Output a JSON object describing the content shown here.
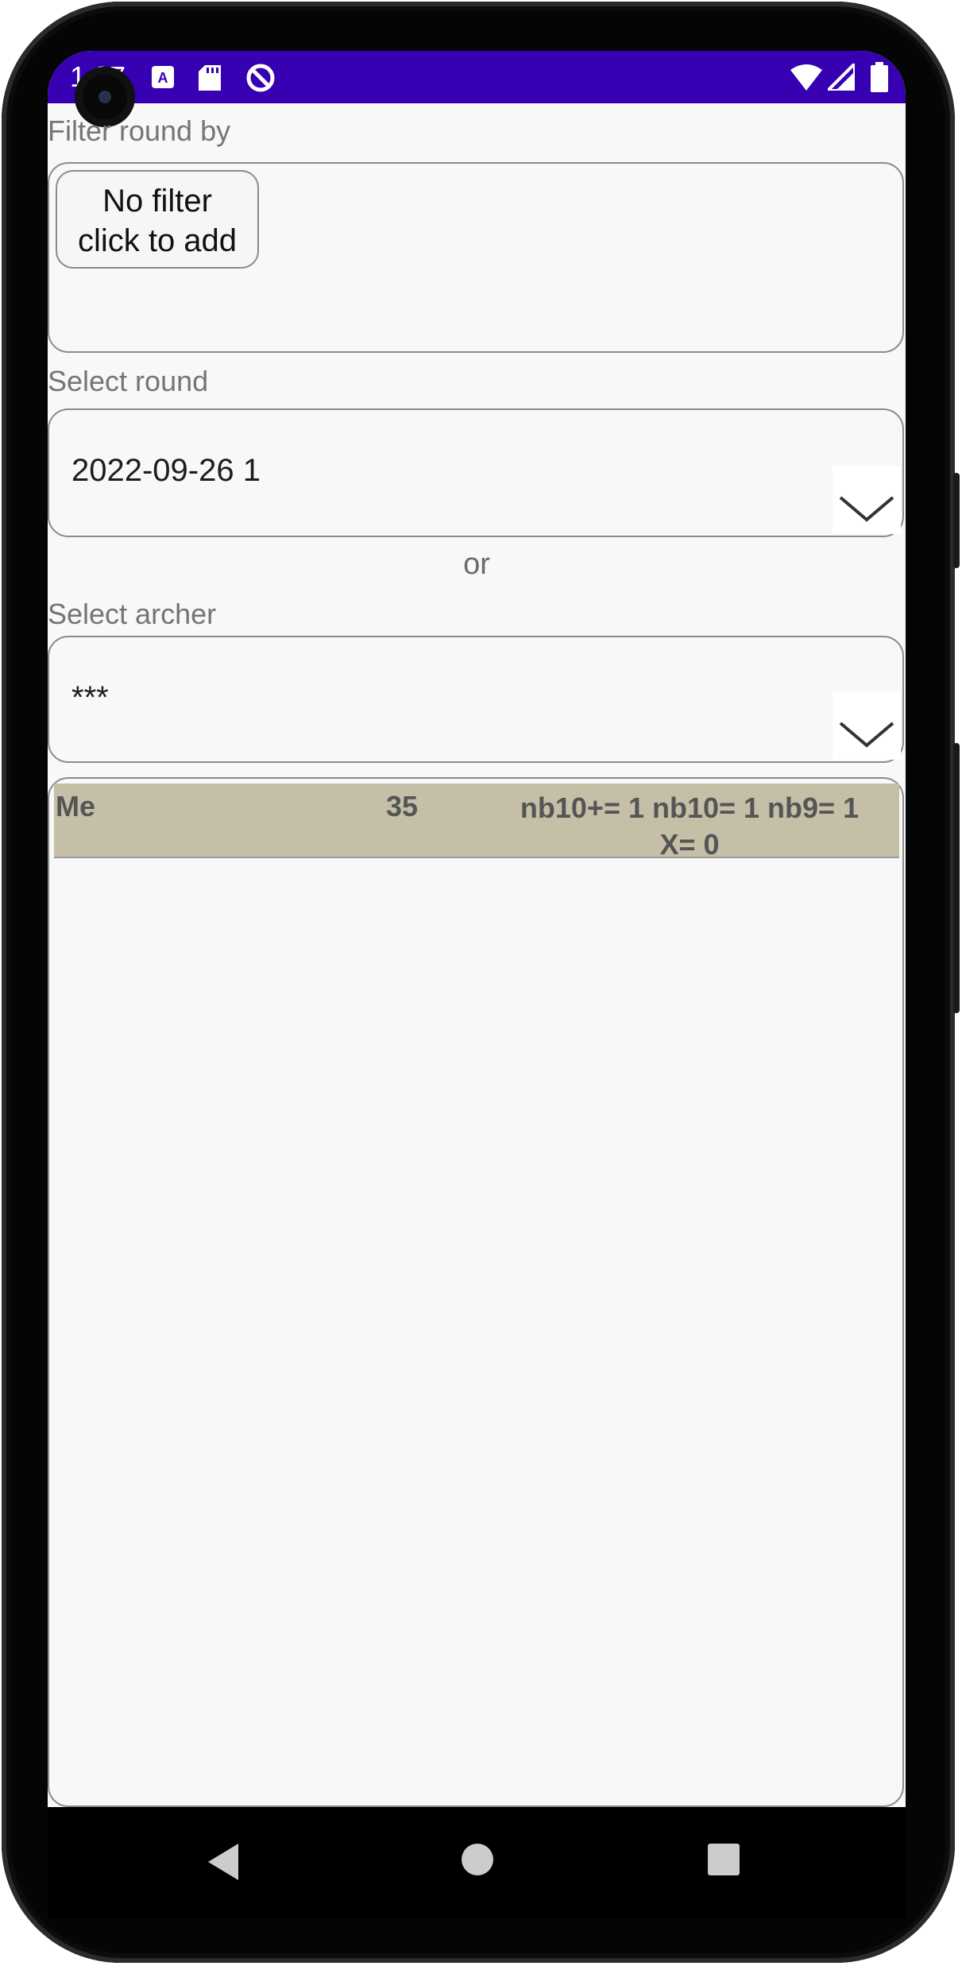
{
  "status_bar": {
    "time": "1:27",
    "left_icons": [
      "font-icon",
      "sd-card-icon",
      "sync-blocked-icon"
    ],
    "right_icons": [
      "wifi-icon",
      "signal-icon",
      "battery-icon"
    ],
    "color": "#3700b3"
  },
  "filter": {
    "label": "Filter round by",
    "button_line1": "No filter",
    "button_line2": "click to add"
  },
  "round": {
    "label": "Select round",
    "value": "2022-09-26 1"
  },
  "or_text": "or",
  "archer": {
    "label": "Select archer",
    "value": "***"
  },
  "results": [
    {
      "name": "Me",
      "score": "35",
      "stats_line1": "nb10+= 1 nb10= 1 nb9= 1",
      "stats_line2": "X= 0"
    }
  ],
  "nav": [
    "back-icon",
    "home-icon",
    "recents-icon"
  ]
}
